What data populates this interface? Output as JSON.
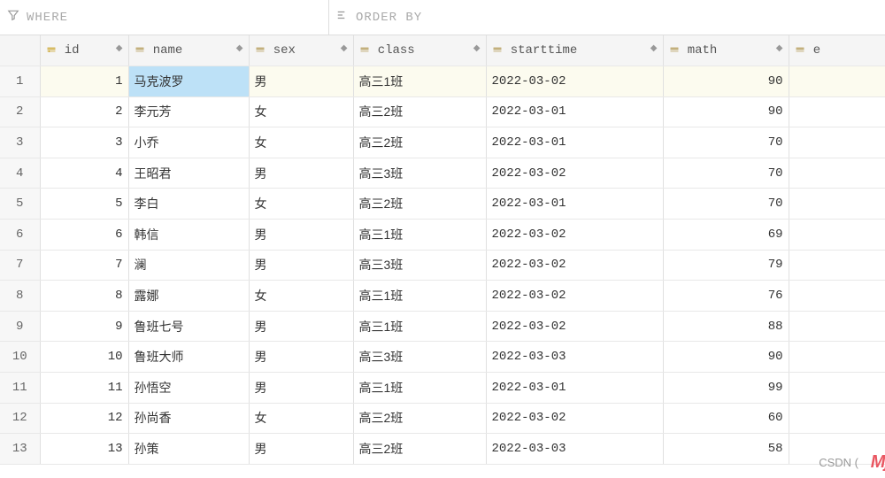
{
  "filters": {
    "where_label": "WHERE",
    "orderby_label": "ORDER BY"
  },
  "columns": {
    "id": "id",
    "name": "name",
    "sex": "sex",
    "class": "class",
    "starttime": "starttime",
    "math": "math",
    "extra": "e"
  },
  "rows": [
    {
      "n": "1",
      "id": "1",
      "name": "马克波罗",
      "sex": "男",
      "class": "高三1班",
      "starttime": "2022-03-02",
      "math": "90"
    },
    {
      "n": "2",
      "id": "2",
      "name": "李元芳",
      "sex": "女",
      "class": "高三2班",
      "starttime": "2022-03-01",
      "math": "90"
    },
    {
      "n": "3",
      "id": "3",
      "name": "小乔",
      "sex": "女",
      "class": "高三2班",
      "starttime": "2022-03-01",
      "math": "70"
    },
    {
      "n": "4",
      "id": "4",
      "name": "王昭君",
      "sex": "男",
      "class": "高三3班",
      "starttime": "2022-03-02",
      "math": "70"
    },
    {
      "n": "5",
      "id": "5",
      "name": "李白",
      "sex": "女",
      "class": "高三2班",
      "starttime": "2022-03-01",
      "math": "70"
    },
    {
      "n": "6",
      "id": "6",
      "name": "韩信",
      "sex": "男",
      "class": "高三1班",
      "starttime": "2022-03-02",
      "math": "69"
    },
    {
      "n": "7",
      "id": "7",
      "name": "澜",
      "sex": "男",
      "class": "高三3班",
      "starttime": "2022-03-02",
      "math": "79"
    },
    {
      "n": "8",
      "id": "8",
      "name": "露娜",
      "sex": "女",
      "class": "高三1班",
      "starttime": "2022-03-02",
      "math": "76"
    },
    {
      "n": "9",
      "id": "9",
      "name": "鲁班七号",
      "sex": "男",
      "class": "高三1班",
      "starttime": "2022-03-02",
      "math": "88"
    },
    {
      "n": "10",
      "id": "10",
      "name": "鲁班大师",
      "sex": "男",
      "class": "高三3班",
      "starttime": "2022-03-03",
      "math": "90"
    },
    {
      "n": "11",
      "id": "11",
      "name": "孙悟空",
      "sex": "男",
      "class": "高三1班",
      "starttime": "2022-03-01",
      "math": "99"
    },
    {
      "n": "12",
      "id": "12",
      "name": "孙尚香",
      "sex": "女",
      "class": "高三2班",
      "starttime": "2022-03-02",
      "math": "60"
    },
    {
      "n": "13",
      "id": "13",
      "name": "孙策",
      "sex": "男",
      "class": "高三2班",
      "starttime": "2022-03-03",
      "math": "58"
    }
  ],
  "selection": {
    "row": 0,
    "col": "name"
  },
  "watermark": {
    "brand": "Mj",
    "text": "CSDN ("
  }
}
